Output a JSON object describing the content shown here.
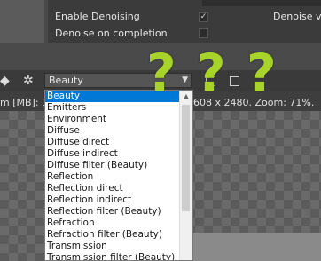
{
  "settings": {
    "enable_denoising_label": "Enable Denoising",
    "enable_denoising_checked": true,
    "denoise_on_completion_label": "Denoise on completion",
    "denoise_on_completion_checked": false,
    "right_label": "Denoise vo"
  },
  "toolbar": {
    "pass_select": "Beauty"
  },
  "status": {
    "left_text": "m [MB]: 17",
    "right_text": "608 x 2480.   Zoom: 71%."
  },
  "dropdown": {
    "items": [
      "Beauty",
      "Emitters",
      "Environment",
      "Diffuse",
      "Diffuse direct",
      "Diffuse indirect",
      "Diffuse filter (Beauty)",
      "Reflection",
      "Reflection direct",
      "Reflection indirect",
      "Reflection filter (Beauty)",
      "Refraction",
      "Refraction filter (Beauty)",
      "Transmission",
      "Transmission filter (Beauty)"
    ],
    "selected_index": 0
  },
  "annotations": {
    "marks": [
      "?",
      "?",
      "?"
    ],
    "color": "#a8d42a"
  },
  "colors": {
    "selection": "#0078d7"
  }
}
